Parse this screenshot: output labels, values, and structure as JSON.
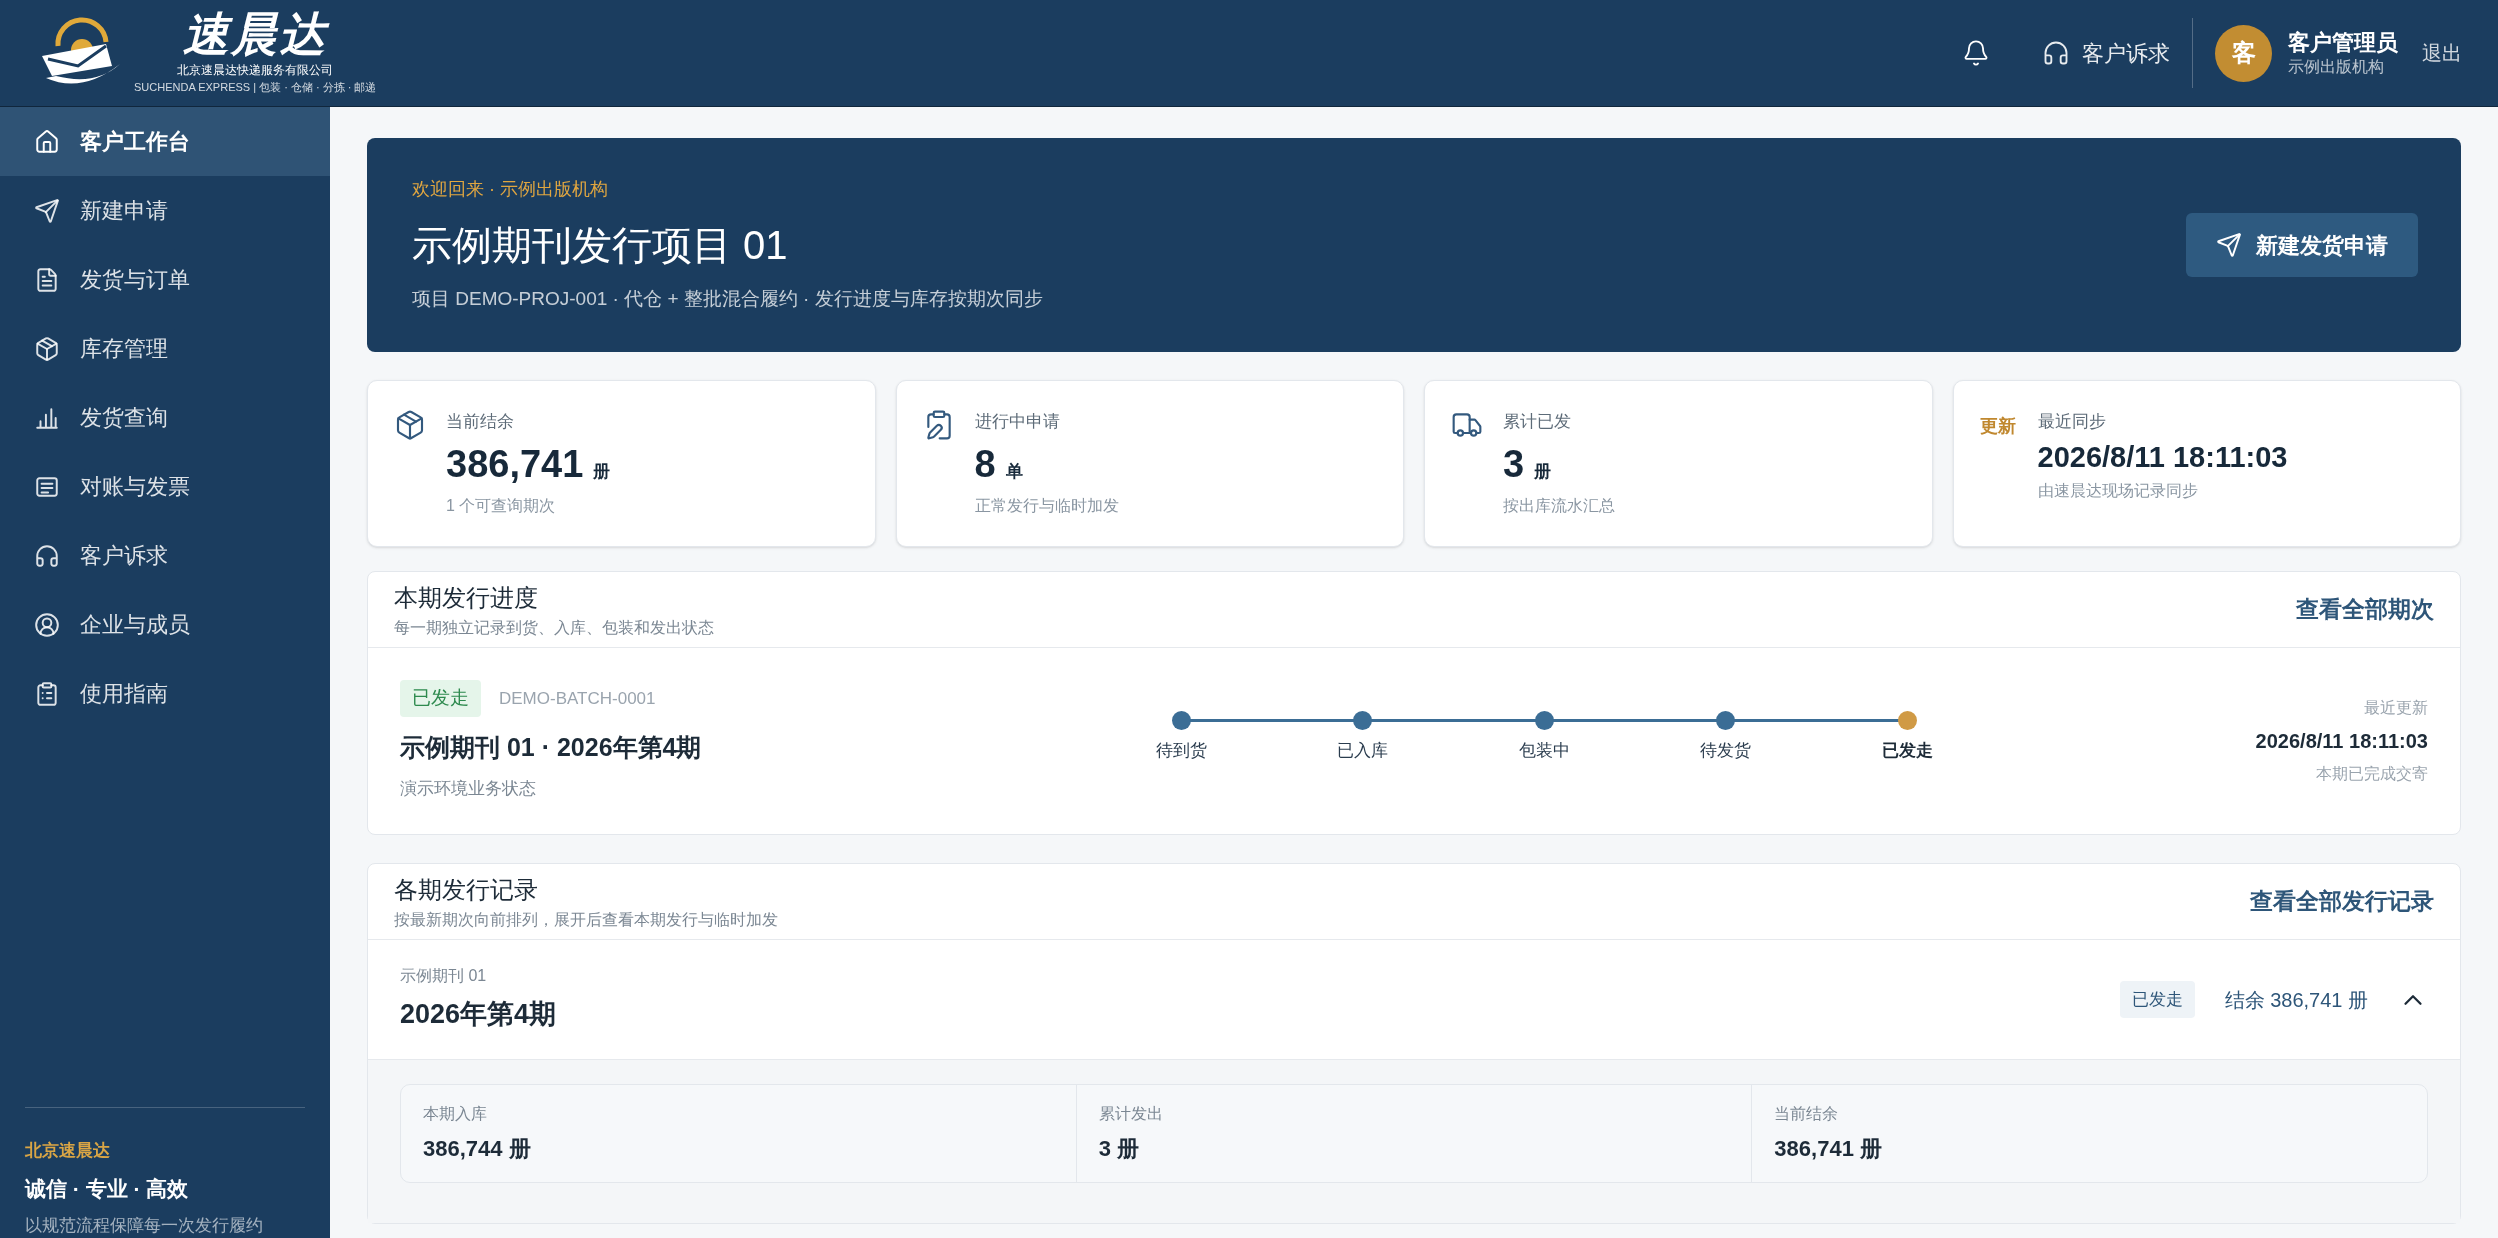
{
  "header": {
    "logo": {
      "name": "速晨达",
      "company": "北京速晨达快递服务有限公司",
      "tagline": "SUCHENDA EXPRESS | 包装 · 仓储 · 分拣 · 邮递"
    },
    "complaint_link": "客户诉求",
    "user": {
      "avatar": "客",
      "name": "客户管理员",
      "org": "示例出版机构"
    },
    "logout": "退出"
  },
  "sidebar": {
    "items": [
      {
        "label": "客户工作台",
        "selected": true
      },
      {
        "label": "新建申请",
        "selected": false
      },
      {
        "label": "发货与订单",
        "selected": false
      },
      {
        "label": "库存管理",
        "selected": false
      },
      {
        "label": "发货查询",
        "selected": false
      },
      {
        "label": "对账与发票",
        "selected": false
      },
      {
        "label": "客户诉求",
        "selected": false
      },
      {
        "label": "企业与成员",
        "selected": false
      },
      {
        "label": "使用指南",
        "selected": false
      }
    ],
    "footer": {
      "brand": "北京速晨达",
      "slogan": "诚信 · 专业 · 高效",
      "note": "以规范流程保障每一次发行履约"
    }
  },
  "hero": {
    "eyebrow": "欢迎回来 · 示例出版机构",
    "title": "示例期刊发行项目 01",
    "subtitle": "项目 DEMO-PROJ-001 · 代仓 + 整批混合履约 · 发行进度与库存按期次同步",
    "button": "新建发货申请"
  },
  "stats": [
    {
      "kind": "metric",
      "label": "当前结余",
      "value": "386,741",
      "unit": "册",
      "note": "1 个可查询期次"
    },
    {
      "kind": "metric",
      "label": "进行中申请",
      "value": "8",
      "unit": "单",
      "note": "正常发行与临时加发"
    },
    {
      "kind": "metric",
      "label": "累计已发",
      "value": "3",
      "unit": "册",
      "note": "按出库流水汇总"
    },
    {
      "kind": "sync",
      "badge": "更新",
      "label": "最近同步",
      "value": "2026/8/11 18:11:03",
      "note": "由速晨达现场记录同步"
    }
  ],
  "progress": {
    "title": "本期发行进度",
    "subtitle": "每一期独立记录到货、入库、包装和发出状态",
    "link": "查看全部期次",
    "batch": {
      "status": "已发走",
      "code": "DEMO-BATCH-0001",
      "title": "示例期刊 01 · 2026年第4期",
      "note": "演示环境业务状态"
    },
    "steps": [
      {
        "label": "待到货",
        "selected": false
      },
      {
        "label": "已入库",
        "selected": false
      },
      {
        "label": "包装中",
        "selected": false
      },
      {
        "label": "待发货",
        "selected": false
      },
      {
        "label": "已发走",
        "selected": true
      }
    ],
    "updated_label": "最近更新",
    "updated": "2026/8/11 18:11:03",
    "updated_note": "本期已完成交寄"
  },
  "records": {
    "title": "各期发行记录",
    "subtitle": "按最新期次向前排列，展开后查看本期发行与临时加发",
    "link": "查看全部发行记录",
    "items": [
      {
        "series": "示例期刊 01",
        "issue": "2026年第4期",
        "status": "已发走",
        "balance": "结余 386,741 册",
        "expanded": true,
        "metrics": [
          {
            "label": "本期入库",
            "value": "386,744 册"
          },
          {
            "label": "累计发出",
            "value": "3 册"
          },
          {
            "label": "当前结余",
            "value": "386,741 册"
          }
        ]
      }
    ]
  }
}
